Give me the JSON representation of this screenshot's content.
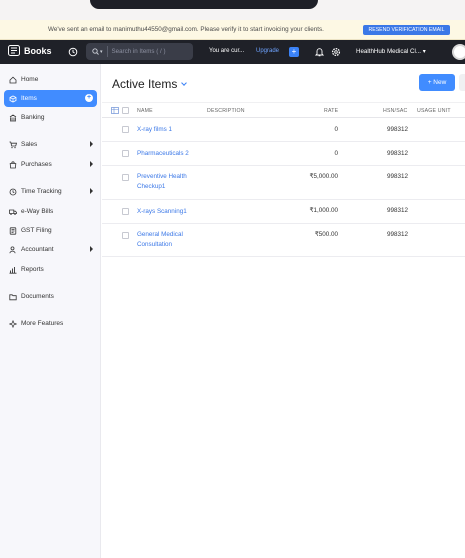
{
  "banner": {
    "message": "We've sent an email to manimuthu44550@gmail.com. Please verify it to start invoicing your clients.",
    "resend_label": "RESEND VERIFICATION EMAIL"
  },
  "nav": {
    "app_name": "Books",
    "search_placeholder": "Search in Items ( / )",
    "trial_text": "You are cur...",
    "upgrade_label": "Upgrade",
    "plus_label": "+",
    "org_name": "HealthHub Medical Cl..."
  },
  "sidebar": {
    "items": [
      {
        "label": "Home",
        "icon": "home-icon"
      },
      {
        "label": "Items",
        "icon": "items-icon",
        "active": true,
        "badge": "+"
      },
      {
        "label": "Banking",
        "icon": "bank-icon"
      },
      {
        "label": "Sales",
        "icon": "cart-icon",
        "arrow": true
      },
      {
        "label": "Purchases",
        "icon": "bag-icon",
        "arrow": true
      },
      {
        "label": "Time Tracking",
        "icon": "clock-icon",
        "arrow": true
      },
      {
        "label": "e-Way Bills",
        "icon": "truck-icon"
      },
      {
        "label": "GST Filing",
        "icon": "gst-icon"
      },
      {
        "label": "Accountant",
        "icon": "accountant-icon",
        "arrow": true
      },
      {
        "label": "Reports",
        "icon": "reports-icon"
      },
      {
        "label": "Documents",
        "icon": "folder-icon"
      },
      {
        "label": "More Features",
        "icon": "features-icon"
      }
    ]
  },
  "main": {
    "title": "Active Items",
    "new_label": "+ New",
    "columns": {
      "name": "NAME",
      "description": "DESCRIPTION",
      "rate": "RATE",
      "hsn": "HSN/SAC",
      "usage": "USAGE UNIT"
    },
    "rows": [
      {
        "name": "X-ray films 1",
        "description": "",
        "rate": "0",
        "hsn": "998312",
        "usage": ""
      },
      {
        "name": "Pharmaceuticals 2",
        "description": "",
        "rate": "0",
        "hsn": "998312",
        "usage": ""
      },
      {
        "name": "Preventive Health Checkup1",
        "description": "",
        "rate": "₹5,000.00",
        "hsn": "998312",
        "usage": ""
      },
      {
        "name": "X-rays Scanning1",
        "description": "",
        "rate": "₹1,000.00",
        "hsn": "998312",
        "usage": ""
      },
      {
        "name": "General Medical Consultation",
        "description": "",
        "rate": "₹500.00",
        "hsn": "998312",
        "usage": ""
      }
    ]
  }
}
